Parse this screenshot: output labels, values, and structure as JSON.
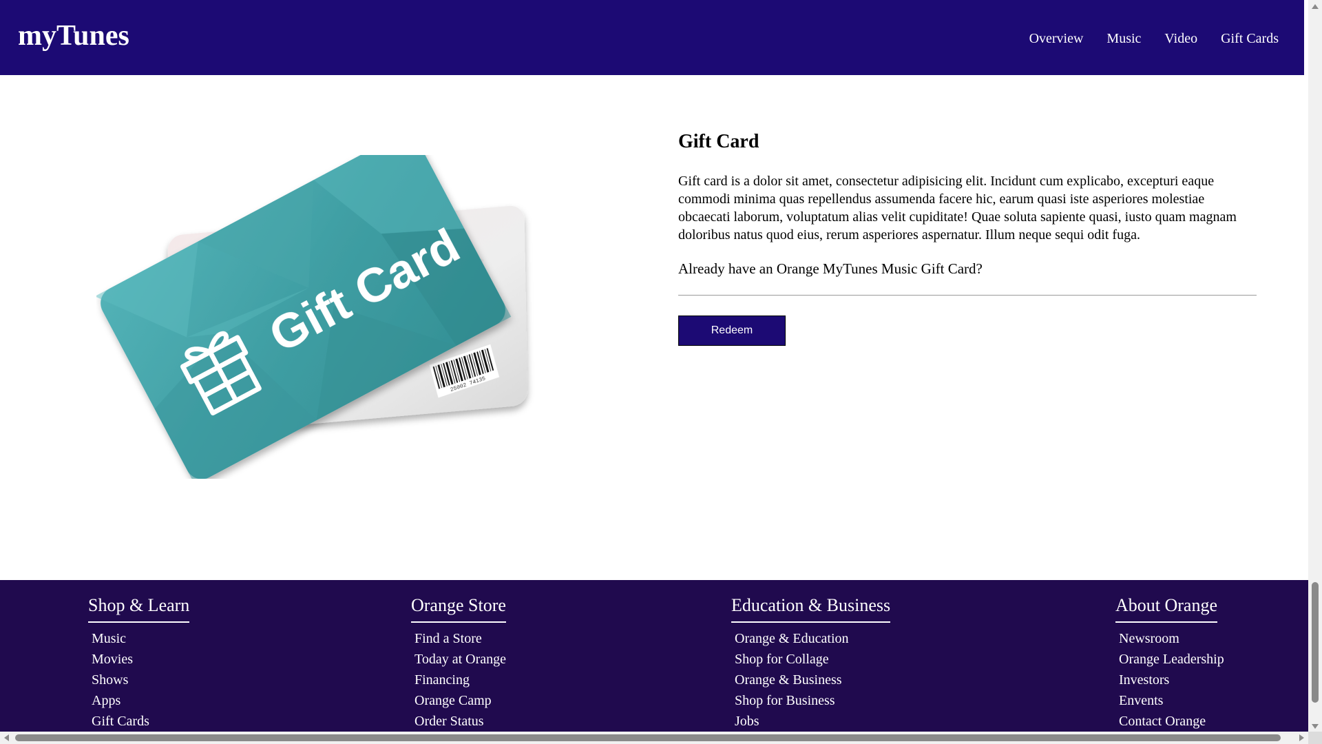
{
  "header": {
    "logo": "myTunes",
    "nav": [
      "Overview",
      "Music",
      "Video",
      "Gift Cards"
    ]
  },
  "main": {
    "image": {
      "card_text": "Gift Card",
      "barcode_number": "25002 74135",
      "card_color": "#4aa8ad"
    },
    "title": "Gift Card",
    "description": "Gift card is a dolor sit amet, consectetur adipisicing elit. Incidunt cum explicabo, excepturi eaque commodi minima quas repellendus assumenda facere hic, earum quasi iste asperiores molestiae obcaecati laborum, voluptatum alias velit cupiditate! Quae soluta sapiente quasi, iusto quam magnam doloribus natus quod eius, rerum asperiores aspernatur. Illum neque sequi odit fuga.",
    "question": "Already have an Orange MyTunes Music Gift Card?",
    "redeem_label": "Redeem"
  },
  "footer": {
    "columns": [
      {
        "title": "Shop & Learn",
        "items": [
          "Music",
          "Movies",
          "Shows",
          "Apps",
          "Gift Cards"
        ]
      },
      {
        "title": "Orange Store",
        "items": [
          "Find a Store",
          "Today at Orange",
          "Financing",
          "Orange Camp",
          "Order Status"
        ]
      },
      {
        "title": "Education & Business",
        "items": [
          "Orange & Education",
          "Shop for Collage",
          "Orange & Business",
          "Shop for Business",
          "Jobs"
        ]
      },
      {
        "title": "About Orange",
        "items": [
          "Newsroom",
          "Orange Leadership",
          "Investors",
          "Envents",
          "Contact Orange"
        ]
      }
    ]
  },
  "colors": {
    "header_bg": "#1c0a74",
    "footer_bg": "#200a4e",
    "button_bg": "#1c0a74"
  }
}
